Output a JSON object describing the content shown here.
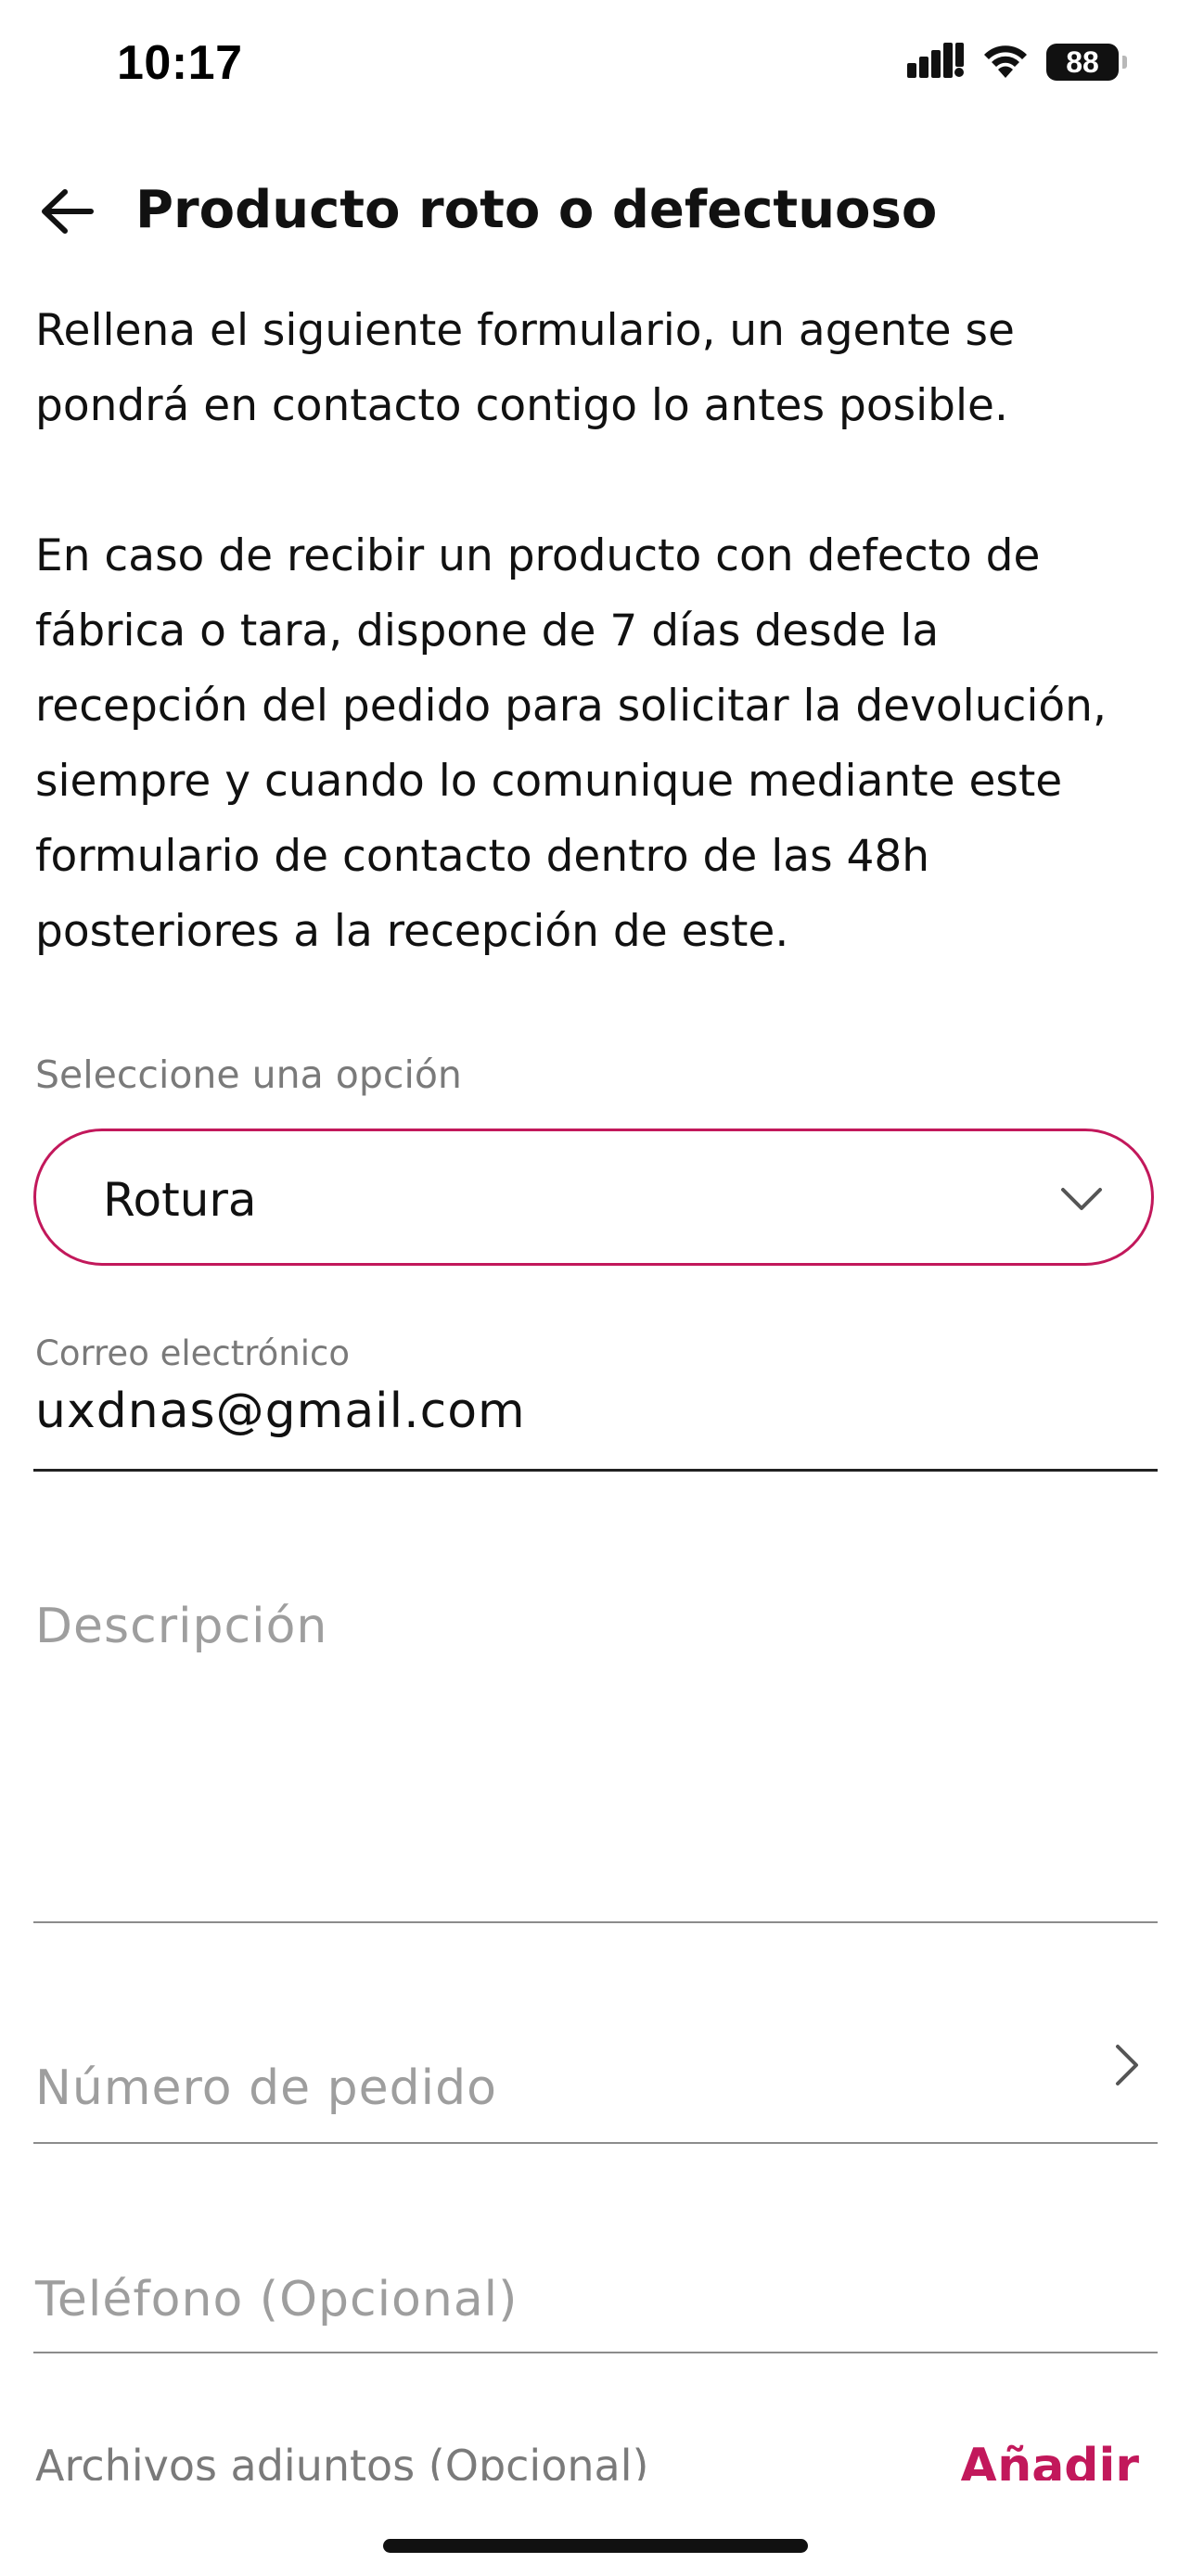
{
  "status_bar": {
    "time": "10:17",
    "battery": "88",
    "icons": [
      "cellular-signal-icon",
      "wifi-icon",
      "battery-icon"
    ]
  },
  "header": {
    "title": "Producto roto o defectuoso",
    "back_icon": "arrow-left-icon"
  },
  "intro": {
    "paragraph_1": "Rellena el siguiente formulario, un agente se pondrá en contacto contigo lo antes posible.",
    "paragraph_2": "En caso de recibir un producto con defecto de fábrica o tara, dispone de 7 días desde la recepción del pedido para solicitar la devolución, siempre y cuando lo comunique mediante este formulario de contacto dentro de las 48h posteriores a la recepción de este."
  },
  "form": {
    "option_select": {
      "label": "Seleccione una opción",
      "selected_value": "Rotura"
    },
    "email": {
      "label": "Correo electrónico",
      "value": "uxdnas@gmail.com"
    },
    "description": {
      "placeholder": "Descripción"
    },
    "order_number": {
      "placeholder": "Número de pedido"
    },
    "phone": {
      "placeholder": "Teléfono (Opcional)"
    },
    "attachments": {
      "label": "Archivos adjuntos (Opcional)",
      "add_label": "Añadir"
    }
  },
  "colors": {
    "accent": "#c2185b",
    "text": "#111111",
    "muted": "#7a7a7a",
    "placeholder": "#9e9e9e"
  }
}
